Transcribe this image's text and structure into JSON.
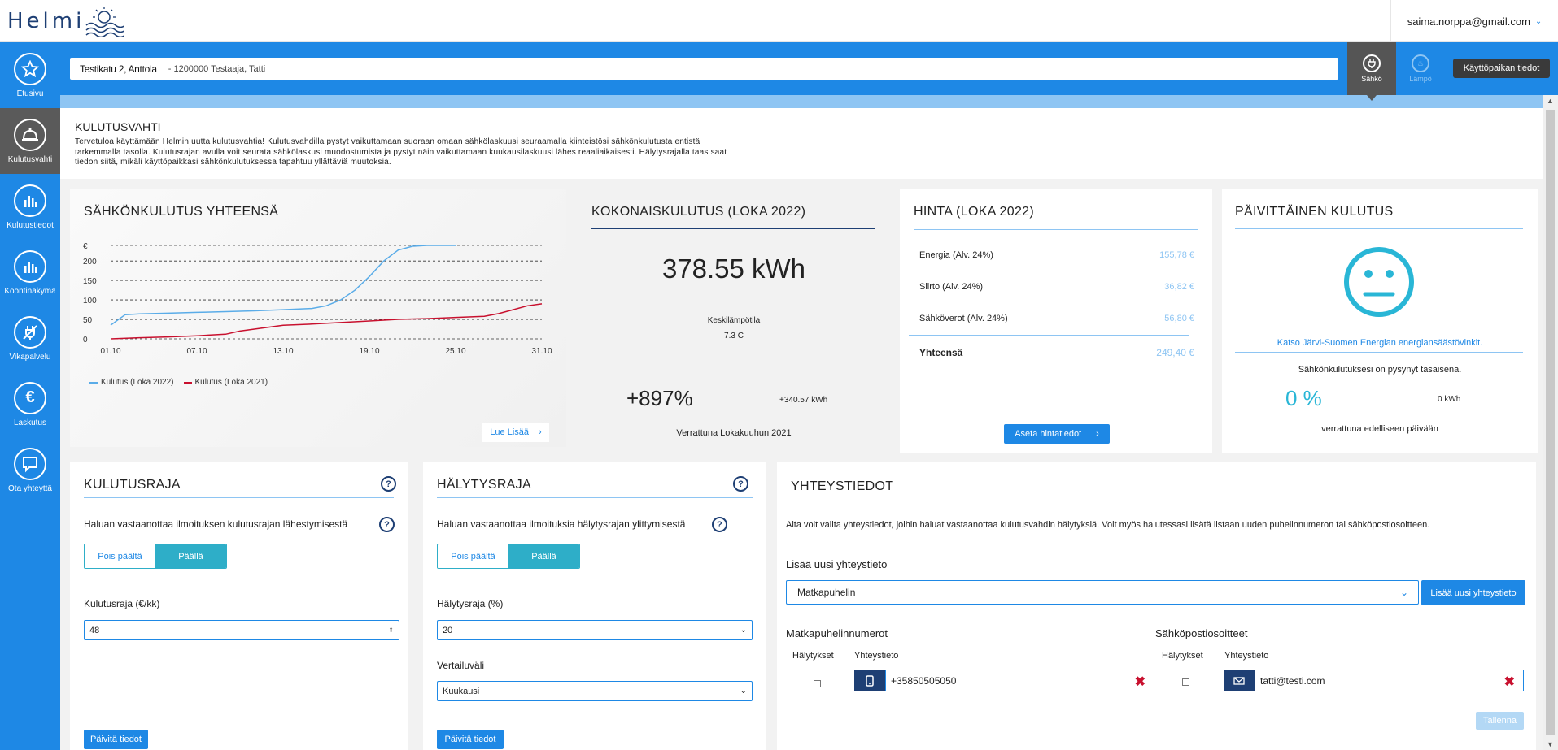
{
  "app": {
    "logo": "Helmi",
    "user_email": "saima.norppa@gmail.com"
  },
  "nav": [
    {
      "label": "Etusivu",
      "icon": "star-icon"
    },
    {
      "label": "Kulutusvahti",
      "icon": "bell-icon"
    },
    {
      "label": "Kulutustiedot",
      "icon": "bar-chart-icon"
    },
    {
      "label": "Koontinäkymä",
      "icon": "bar-chart-icon"
    },
    {
      "label": "Vikapalvelu",
      "icon": "no-power-icon"
    },
    {
      "label": "Laskutus",
      "icon": "euro-icon"
    },
    {
      "label": "Ota yhteyttä",
      "icon": "chat-icon"
    }
  ],
  "header": {
    "street": "Testikatu 2, Anttola",
    "meta": "- 1200000 Testaaja, Tatti",
    "tab_sahko": "Sähkö",
    "tab_lampo": "Lämpö",
    "kayttopaikka_button": "Käyttöpaikan tiedot"
  },
  "intro": {
    "title": "KULUTUSVAHTI",
    "text": "Tervetuloa käyttämään Helmin uutta kulutusvahtia! Kulutusvahdilla pystyt vaikuttamaan suoraan omaan sähkölaskuusi seuraamalla kiinteistösi sähkönkulutusta entistä tarkemmalla tasolla. Kulutusrajan avulla voit seurata sähkölaskusi muodostumista ja pystyt näin vaikuttamaan kuukausilaskuusi lähes reaaliaikaisesti. Hälytysrajalla taas saat tiedon siitä, mikäli käyttöpaikkasi sähkönkulutuksessa tapahtuu yllättäviä muutoksia."
  },
  "total_card": {
    "title": "SÄHKÖNKULUTUS YHTEENSÄ",
    "read_more": "Lue Lisää"
  },
  "chart_data": {
    "type": "line",
    "title": "SÄHKÖNKULUTUS YHTEENSÄ",
    "ylabel": "€",
    "ylim": [
      0,
      240
    ],
    "yticks": [
      0,
      50,
      100,
      150,
      200
    ],
    "grid": true,
    "legend_position": "bottom-left",
    "x_ticks": [
      "01.10",
      "07.10",
      "13.10",
      "19.10",
      "25.10",
      "31.10"
    ],
    "x_range": [
      1,
      31
    ],
    "series": [
      {
        "name": "Kulutus (Loka 2022)",
        "color": "#5aace8",
        "x": [
          1,
          2,
          3,
          5,
          7,
          9,
          11,
          13,
          15,
          16,
          17,
          18,
          19,
          20,
          21,
          22,
          23,
          24,
          25
        ],
        "y": [
          35,
          62,
          64,
          66,
          68,
          70,
          72,
          75,
          78,
          85,
          100,
          125,
          160,
          200,
          228,
          238,
          240,
          240,
          240
        ]
      },
      {
        "name": "Kulutus (Loka 2021)",
        "color": "#c8102e",
        "x": [
          1,
          3,
          5,
          7,
          9,
          10,
          11,
          12,
          13,
          15,
          17,
          19,
          21,
          23,
          25,
          27,
          28,
          29,
          30,
          31
        ],
        "y": [
          0,
          3,
          5,
          8,
          12,
          20,
          25,
          30,
          35,
          38,
          42,
          46,
          50,
          52,
          55,
          58,
          65,
          75,
          85,
          90
        ]
      }
    ]
  },
  "kokonais": {
    "title": "KOKONAISKULUTUS (LOKA 2022)",
    "value": "378.55 kWh",
    "temp_label": "Keskilämpötila",
    "temp_value": "7.3 C",
    "pct": "+897%",
    "diff": "+340.57 kWh",
    "compare": "Verrattuna Lokakuuhun 2021"
  },
  "hinta": {
    "title": "HINTA (LOKA 2022)",
    "rows": [
      {
        "label": "Energia (Alv. 24%)",
        "value": "155,78 €"
      },
      {
        "label": "Siirto (Alv. 24%)",
        "value": "36,82 €"
      },
      {
        "label": "Sähköverot (Alv. 24%)",
        "value": "56,80 €"
      }
    ],
    "total_label": "Yhteensä",
    "total_value": "249,40 €",
    "button": "Aseta hintatiedot"
  },
  "paivittainen": {
    "title": "PÄIVITTÄINEN KULUTUS",
    "link": "Katso Järvi-Suomen Energian energiansäästövinkit.",
    "status": "Sähkönkulutuksesi on pysynyt tasaisena.",
    "pct": "0 %",
    "kwh": "0 kWh",
    "compare": "verrattuna edelliseen päivään"
  },
  "kulutusraja": {
    "title": "KULUTUSRAJA",
    "question": "Haluan vastaanottaa ilmoituksen kulutusrajan lähestymisestä",
    "off": "Pois päältä",
    "on": "Päällä",
    "field_label": "Kulutusraja (€/kk)",
    "field_value": "48",
    "button": "Päivitä tiedot"
  },
  "halytysraja": {
    "title": "HÄLYTYSRAJA",
    "question": "Haluan vastaanottaa ilmoituksia hälytysrajan ylittymisestä",
    "off": "Pois päältä",
    "on": "Päällä",
    "field_label": "Hälytysraja (%)",
    "field_value": "20",
    "period_label": "Vertailuväli",
    "period_value": "Kuukausi",
    "button": "Päivitä tiedot"
  },
  "yhteystiedot": {
    "title": "YHTEYSTIEDOT",
    "text": "Alta voit valita yhteystiedot, joihin haluat vastaanottaa kulutusvahdin hälytyksiä. Voit myös halutessasi lisätä listaan uuden puhelinnumeron tai sähköpostiosoitteen.",
    "add_label": "Lisää uusi yhteystieto",
    "select_value": "Matkapuhelin",
    "add_button": "Lisää uusi yhteystieto",
    "phones_title": "Matkapuhelinnumerot",
    "emails_title": "Sähköpostiosoitteet",
    "col_alerts": "Hälytykset",
    "col_contact": "Yhteystieto",
    "phone": "+35850505050",
    "email": "tatti@testi.com",
    "save_button": "Tallenna"
  }
}
